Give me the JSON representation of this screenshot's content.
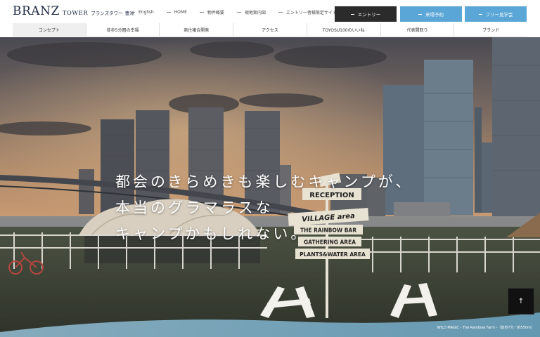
{
  "logo": {
    "brand": "BRANZ",
    "tower": "TOWER",
    "sub": "ブランズタワー",
    "area": "豊洲"
  },
  "top_links": [
    {
      "label": "English"
    },
    {
      "label": "HOME"
    },
    {
      "label": "物件概要"
    },
    {
      "label": "現地案内図"
    },
    {
      "label": "エントリー者様限定サイト"
    }
  ],
  "cta": {
    "entry": "エントリー",
    "visit": "来場予約",
    "tour": "フリー見学会"
  },
  "nav": [
    {
      "label": "コンセプト"
    },
    {
      "label": "徒歩5分圏の幸福"
    },
    {
      "label": "商住複合開発"
    },
    {
      "label": "アクセス"
    },
    {
      "label": "TOYOSU100のいいね"
    },
    {
      "label": "代表間取り"
    },
    {
      "label": "ブランド"
    }
  ],
  "hero": {
    "line1": "都会のきらめきも楽しむキャンプが、",
    "line2": "本当のグラマラスな",
    "line3": "キャンプかもしれない。",
    "sign_reception": "RECEPTION",
    "sign_village": "VILLAGE area",
    "sign_bar": "THE RAINBOW BAR",
    "sign_gathering": "GATHERING AREA",
    "sign_plants": "PLANTS&WATER AREA",
    "caption": "WILD MAGIC - The Rainbow Farm -（徒歩7分／約550m）",
    "to_top": "↑"
  },
  "colors": {
    "logo": "#1e2a44",
    "cta_dark": "#2b2b2b",
    "cta_blue": "#5aa6d6"
  }
}
